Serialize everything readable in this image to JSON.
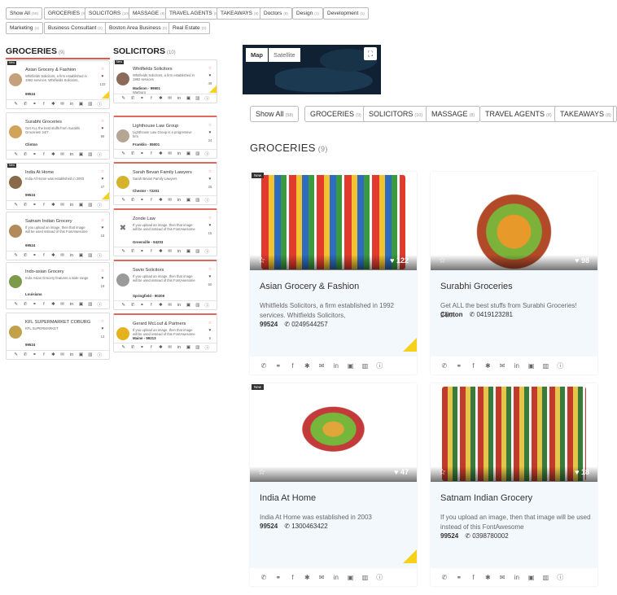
{
  "top_filters": [
    {
      "label": "Show All",
      "count": "(58)"
    },
    {
      "label": "GROCERIES",
      "count": "(9)"
    },
    {
      "label": "SOLICITORS",
      "count": "(10)"
    },
    {
      "label": "MASSAGE",
      "count": "(8)"
    },
    {
      "label": "TRAVEL AGENTS",
      "count": "(8)"
    },
    {
      "label": "TAKEAWAYS",
      "count": "(8)"
    },
    {
      "label": "Doctors",
      "count": "(8)"
    },
    {
      "label": "Design",
      "count": "(1)"
    },
    {
      "label": "Development",
      "count": "(1)"
    },
    {
      "label": "Marketing",
      "count": "(1)"
    },
    {
      "label": "Business Consultant",
      "count": "(0)"
    },
    {
      "label": "Boston Area Business",
      "count": "(0)"
    },
    {
      "label": "Real Estate",
      "count": "(0)"
    }
  ],
  "groceries": {
    "title": "GROCERIES",
    "count": "(9)",
    "items": [
      {
        "badge": "New",
        "name": "Asian Grocery & Fashion",
        "desc": "Whitfields Solicitors, a firm established in 1992 services. Whitfields Solicitors,",
        "loc": "99524",
        "count": "122"
      },
      {
        "badge": "",
        "name": "Surabhi Groceries",
        "desc": "Get ALL the best stuffs from Surabhi Groceries! 24/7.",
        "loc": "Clinton",
        "count": "98"
      },
      {
        "badge": "New",
        "name": "India At Home",
        "desc": "India At Home was established in 2003",
        "loc": "99524",
        "count": "47"
      },
      {
        "badge": "",
        "name": "Satnam Indian Grocery",
        "desc": "If you upload an image, then that image will be used instead of this FontAwesome",
        "loc": "99524",
        "count": "18"
      },
      {
        "badge": "",
        "name": "Indo-asian Grocery",
        "desc": "Indo-Asian Grocery features a wide range",
        "loc": "Louisiana",
        "count": "19"
      },
      {
        "badge": "",
        "name": "KFL SUPERMARKET COBURG",
        "desc": "KFL SUPERMARKET",
        "loc": "99524",
        "count": "13"
      }
    ]
  },
  "solicitors": {
    "title": "SOLICITORS",
    "count": "(10)",
    "items": [
      {
        "badge": "New",
        "name": "Whitfields Solicitors",
        "desc": "Whitfields Solicitors, a firm established in 1992 services",
        "loc": "Madison - 99501",
        "sub": "Warburg",
        "count": "49"
      },
      {
        "badge": "",
        "name": "Lighthouse Law Group",
        "desc": "Lighthouse Law Group is a progressive firm",
        "loc": "Franklin - 85001",
        "sub": "",
        "count": "24"
      },
      {
        "badge": "",
        "name": "Sarah Bevan Family Lawyers",
        "desc": "Sarah Bevan Family Lawyers",
        "loc": "Chester - 72201",
        "sub": "",
        "count": "25"
      },
      {
        "badge": "",
        "name": "Zonde Law",
        "desc": "If you upload an image, then that image will be used instead of this FontAwesome",
        "loc": "Greenville - 94203",
        "sub": "",
        "count": "15"
      },
      {
        "badge": "",
        "name": "Savio Solicitors",
        "desc": "If you upload an image, then that image will be used instead of this FontAwesome",
        "loc": "Springfield - 90209",
        "sub": "",
        "count": "50"
      },
      {
        "badge": "",
        "name": "Gerard McLouf & Partners",
        "desc": "If you upload an image, then that image will be used instead of this FontAwesome",
        "loc": "Maine - 99213",
        "sub": "",
        "count": "5"
      }
    ]
  },
  "map": {
    "tab_map": "Map",
    "tab_satellite": "Satellite"
  },
  "filter_bar": [
    {
      "label": "Show All",
      "count": "(58)"
    },
    {
      "label": "GROCERIES",
      "count": "(9)"
    },
    {
      "label": "SOLICITORS",
      "count": "(10)"
    },
    {
      "label": "MASSAGE",
      "count": "(8)"
    },
    {
      "label": "TRAVEL AGENTS",
      "count": "(8)"
    },
    {
      "label": "TAKEAWAYS",
      "count": "(8)"
    }
  ],
  "main": {
    "title": "GROCERIES",
    "count": "(9)",
    "cards": [
      {
        "badge": "New",
        "name": "Asian Grocery & Fashion",
        "desc": "Whitfields Solicitors, a firm established in 1992 services. Whitfields Solicitors,",
        "zip": "99524",
        "phone": "0249544257",
        "likes": "122"
      },
      {
        "badge": "",
        "name": "Surabhi Groceries",
        "desc": "Get ALL the best stuffs from Surabhi Groceries! 24/7.",
        "zip": "Clinton",
        "phone": "0419123281",
        "likes": "98"
      },
      {
        "badge": "New",
        "name": "India At Home",
        "desc": "India At Home was established in 2003",
        "zip": "99524",
        "phone": "1300463422",
        "likes": "47"
      },
      {
        "badge": "",
        "name": "Satnam Indian Grocery",
        "desc": "If you upload an image, then that image will be used instead of this FontAwesome",
        "zip": "99524",
        "phone": "0398780002",
        "likes": "18"
      }
    ]
  },
  "icons": [
    "phone-icon",
    "link-icon",
    "facebook-icon",
    "yelp-icon",
    "email-icon",
    "linkedin-icon",
    "twitter-icon",
    "map-icon",
    "info-icon"
  ],
  "colors": {
    "accent": "#e05a50",
    "bolt": "#f5d11c",
    "card_body": "#f3f8fd"
  }
}
